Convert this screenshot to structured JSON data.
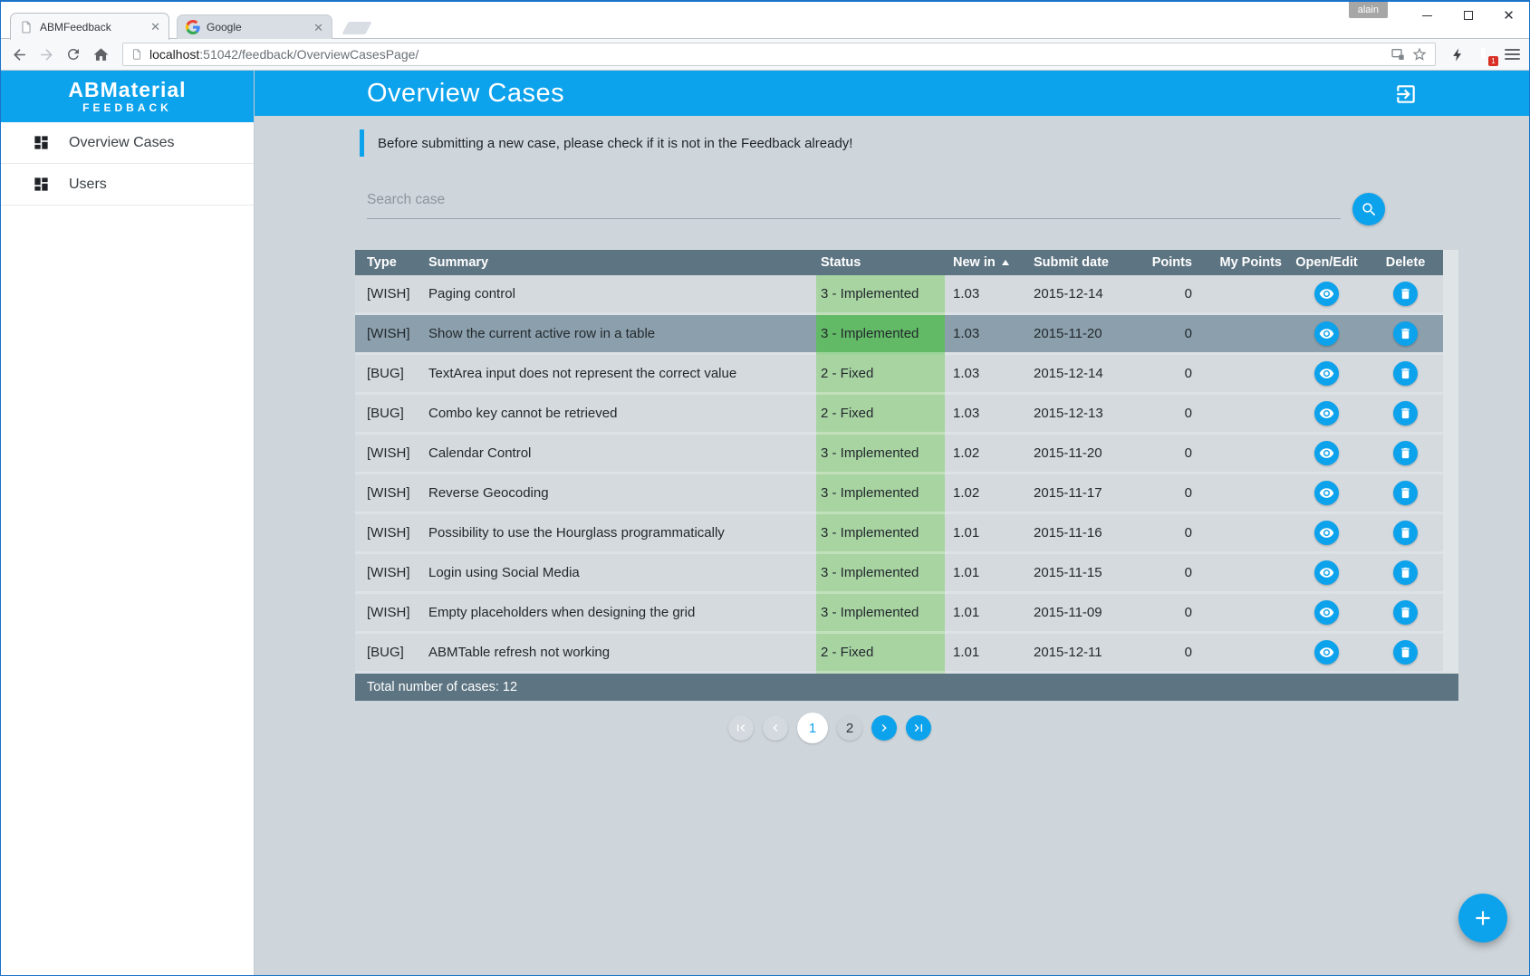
{
  "browser": {
    "tabs": [
      {
        "title": "ABMFeedback",
        "active": true
      },
      {
        "title": "Google",
        "active": false
      }
    ],
    "profile_name": "alain",
    "url": {
      "host": "localhost",
      "rest": ":51042/feedback/OverviewCasesPage/"
    },
    "extension_badge": "1"
  },
  "sidebar": {
    "logo_line1": "ABMaterial",
    "logo_line2": "FEEDBACK",
    "items": [
      {
        "label": "Overview Cases"
      },
      {
        "label": "Users"
      }
    ]
  },
  "header": {
    "title": "Overview Cases"
  },
  "notice": "Before submitting a new case, please check if it is not in the Feedback already!",
  "search": {
    "placeholder": "Search case"
  },
  "table": {
    "columns": [
      "Type",
      "Summary",
      "Status",
      "New in",
      "Submit date",
      "Points",
      "My Points",
      "Open/Edit",
      "Delete"
    ],
    "sort_column": "New in",
    "sort_direction": "asc",
    "rows": [
      {
        "type": "[WISH]",
        "summary": "Paging control",
        "status": "3 - Implemented",
        "new_in": "1.03",
        "submit_date": "2015-12-14",
        "points": "0",
        "my_points": "",
        "selected": false
      },
      {
        "type": "[WISH]",
        "summary": "Show the current active row in a table",
        "status": "3 - Implemented",
        "new_in": "1.03",
        "submit_date": "2015-11-20",
        "points": "0",
        "my_points": "",
        "selected": true
      },
      {
        "type": "[BUG]",
        "summary": "TextArea input does not represent the correct value",
        "status": "2 - Fixed",
        "new_in": "1.03",
        "submit_date": "2015-12-14",
        "points": "0",
        "my_points": "",
        "selected": false
      },
      {
        "type": "[BUG]",
        "summary": "Combo key cannot be retrieved",
        "status": "2 - Fixed",
        "new_in": "1.03",
        "submit_date": "2015-12-13",
        "points": "0",
        "my_points": "",
        "selected": false
      },
      {
        "type": "[WISH]",
        "summary": "Calendar Control",
        "status": "3 - Implemented",
        "new_in": "1.02",
        "submit_date": "2015-11-20",
        "points": "0",
        "my_points": "",
        "selected": false
      },
      {
        "type": "[WISH]",
        "summary": "Reverse Geocoding",
        "status": "3 - Implemented",
        "new_in": "1.02",
        "submit_date": "2015-11-17",
        "points": "0",
        "my_points": "",
        "selected": false
      },
      {
        "type": "[WISH]",
        "summary": "Possibility to use the Hourglass programmatically",
        "status": "3 - Implemented",
        "new_in": "1.01",
        "submit_date": "2015-11-16",
        "points": "0",
        "my_points": "",
        "selected": false
      },
      {
        "type": "[WISH]",
        "summary": "Login using Social Media",
        "status": "3 - Implemented",
        "new_in": "1.01",
        "submit_date": "2015-11-15",
        "points": "0",
        "my_points": "",
        "selected": false
      },
      {
        "type": "[WISH]",
        "summary": "Empty placeholders when designing the grid",
        "status": "3 - Implemented",
        "new_in": "1.01",
        "submit_date": "2015-11-09",
        "points": "0",
        "my_points": "",
        "selected": false
      },
      {
        "type": "[BUG]",
        "summary": "ABMTable refresh not working",
        "status": "2 - Fixed",
        "new_in": "1.01",
        "submit_date": "2015-12-11",
        "points": "0",
        "my_points": "",
        "selected": false
      }
    ],
    "footer": "Total number of cases: 12"
  },
  "pagination": {
    "pages": [
      "1",
      "2"
    ],
    "current": "1"
  },
  "colors": {
    "accent_blue": "#0da2ec",
    "table_header_bar": "#5d7482",
    "status_green": "#a8d4a2",
    "status_green_selected": "#62ba66",
    "selected_row": "#8ba0ac",
    "content_background": "#cfd6db"
  }
}
